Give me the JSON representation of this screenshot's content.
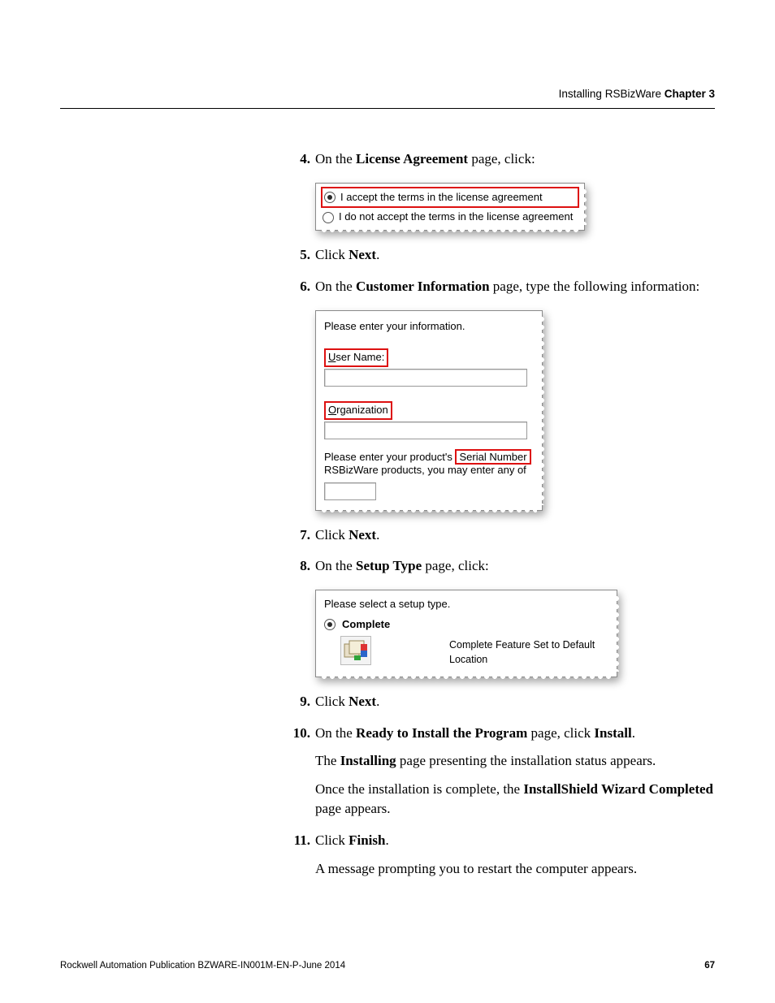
{
  "header": {
    "section": "Installing RSBizWare",
    "chapter_label": "Chapter 3"
  },
  "steps": [
    {
      "n": "4.",
      "text_pre": "On the ",
      "bold1": "License Agreement",
      "text_post": " page, click:"
    },
    {
      "n": "5.",
      "text_pre": "Click ",
      "bold1": "Next",
      "text_post": "."
    },
    {
      "n": "6.",
      "text_pre": "On the ",
      "bold1": "Customer Information",
      "text_post": " page, type the following information:"
    },
    {
      "n": "7.",
      "text_pre": "Click ",
      "bold1": "Next",
      "text_post": "."
    },
    {
      "n": "8.",
      "text_pre": "On the ",
      "bold1": "Setup Type",
      "text_post": " page, click:"
    },
    {
      "n": "9.",
      "text_pre": "Click ",
      "bold1": "Next",
      "text_post": "."
    },
    {
      "n": "10.",
      "text_pre": "On the ",
      "bold1": "Ready to Install the Program",
      "text_mid": " page, click ",
      "bold2": "Install",
      "text_post": "."
    },
    {
      "n": "11.",
      "text_pre": "Click ",
      "bold1": "Finish",
      "text_post": "."
    }
  ],
  "para10a_pre": "The ",
  "para10a_b": "Installing",
  "para10a_post": " page presenting the installation status appears.",
  "para10b_pre": "Once the installation is complete, the ",
  "para10b_b": "InstallShield Wizard Completed",
  "para10b_post": " page appears.",
  "para11": "A message prompting you to restart the computer appears.",
  "fig_license": {
    "opt_accept": "I accept the terms in the license agreement",
    "opt_reject": "I do not accept the terms in the license agreement"
  },
  "fig_cust": {
    "prompt": "Please enter your information.",
    "user_label": "User Name:",
    "org_label": "Organization",
    "serial_pre": "Please enter your product's",
    "serial_hl": "Serial Number",
    "serial_line2": "RSBizWare products, you may enter any of"
  },
  "fig_setup": {
    "prompt": "Please select a setup type.",
    "complete": "Complete",
    "desc": "Complete Feature Set to Default Location"
  },
  "footer": {
    "pub": "Rockwell Automation Publication BZWARE-IN001M-EN-P-June 2014",
    "page": "67"
  }
}
